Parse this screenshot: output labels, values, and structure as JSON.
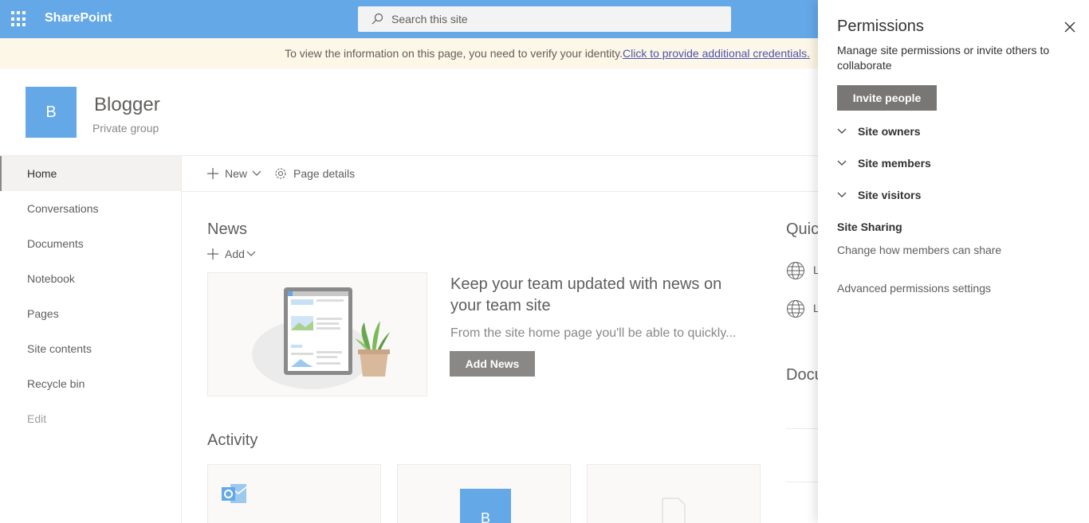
{
  "suitebar": {
    "brand": "SharePoint",
    "search_placeholder": "Search this site",
    "color": "#64a8e8"
  },
  "infobar": {
    "message": "To view the information on this page, you need to verify your identity.",
    "link": "Click to provide additional credentials."
  },
  "site": {
    "logo_letter": "B",
    "title": "Blogger",
    "subtitle": "Private group"
  },
  "leftnav": {
    "items": [
      {
        "label": "Home",
        "active": true
      },
      {
        "label": "Conversations"
      },
      {
        "label": "Documents"
      },
      {
        "label": "Notebook"
      },
      {
        "label": "Pages"
      },
      {
        "label": "Site contents"
      },
      {
        "label": "Recycle bin"
      }
    ],
    "edit": "Edit"
  },
  "commandbar": {
    "new": "New",
    "page_details": "Page details"
  },
  "news": {
    "heading": "News",
    "add": "Add",
    "card_title": "Keep your team updated with news on your team site",
    "card_desc": "From the site home page you'll be able to quickly...",
    "add_news_button": "Add News"
  },
  "activity": {
    "heading": "Activity",
    "card2_letter": "B"
  },
  "right_column": {
    "quick_links_heading": "Quic",
    "documents_heading": "Docu",
    "link_initial_1": "L",
    "link_initial_2": "L"
  },
  "permissions_panel": {
    "title": "Permissions",
    "description": "Manage site permissions or invite others to collaborate",
    "invite_button": "Invite people",
    "groups": [
      {
        "label": "Site owners"
      },
      {
        "label": "Site members"
      },
      {
        "label": "Site visitors"
      }
    ],
    "site_sharing_heading": "Site Sharing",
    "change_sharing_link": "Change how members can share",
    "advanced_link": "Advanced permissions settings"
  }
}
